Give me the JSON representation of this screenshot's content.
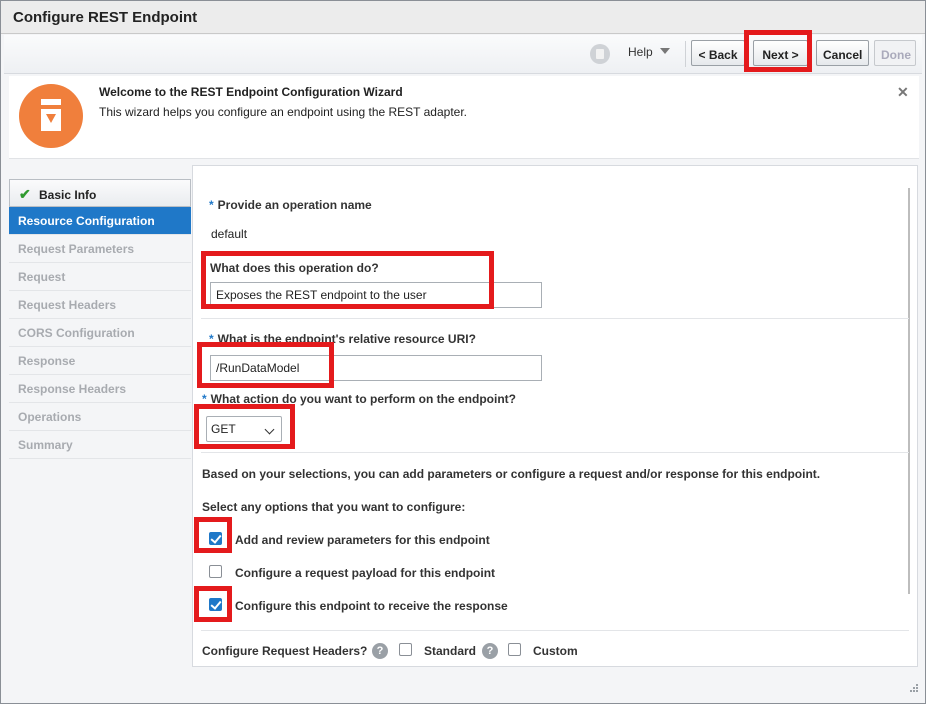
{
  "window": {
    "title": "Configure REST Endpoint"
  },
  "toolbar": {
    "help_label": "Help",
    "back_label": "< Back",
    "next_label": "Next >",
    "cancel_label": "Cancel",
    "done_label": "Done"
  },
  "welcome": {
    "heading": "Welcome to the REST Endpoint Configuration Wizard",
    "description": "This wizard helps you configure an endpoint using the REST adapter.",
    "close_glyph": "✕"
  },
  "nav": {
    "items": [
      {
        "label": "Basic Info",
        "state": "done"
      },
      {
        "label": "Resource Configuration",
        "state": "active"
      },
      {
        "label": "Request Parameters",
        "state": "disabled"
      },
      {
        "label": "Request",
        "state": "disabled"
      },
      {
        "label": "Request Headers",
        "state": "disabled"
      },
      {
        "label": "CORS Configuration",
        "state": "disabled"
      },
      {
        "label": "Response",
        "state": "disabled"
      },
      {
        "label": "Response Headers",
        "state": "disabled"
      },
      {
        "label": "Operations",
        "state": "disabled"
      },
      {
        "label": "Summary",
        "state": "disabled"
      }
    ]
  },
  "form": {
    "required_marker": "*",
    "operation_name_label": "Provide an operation name",
    "operation_name_value": "default",
    "operation_desc_label": "What does this operation do?",
    "operation_desc_value": "Exposes the REST endpoint to the user",
    "uri_label": "What is the endpoint's relative resource URI?",
    "uri_value": "/RunDataModel",
    "action_label": "What action do you want to perform on the endpoint?",
    "action_value": "GET",
    "based_on_text": "Based on your selections, you can add parameters or configure a request and/or response for this endpoint.",
    "select_options_text": "Select any options that you want to configure:",
    "options": [
      {
        "label": "Add and review parameters for this endpoint",
        "checked": true
      },
      {
        "label": "Configure a request payload for this endpoint",
        "checked": false
      },
      {
        "label": "Configure this endpoint to receive the response",
        "checked": true
      }
    ],
    "req_headers_label": "Configure Request Headers?",
    "help_glyph": "?",
    "standard_label": "Standard",
    "custom_label": "Custom"
  },
  "colors": {
    "accent": "#1f78c8",
    "highlight": "#e41a1c",
    "wizard_icon": "#f07f3c"
  }
}
